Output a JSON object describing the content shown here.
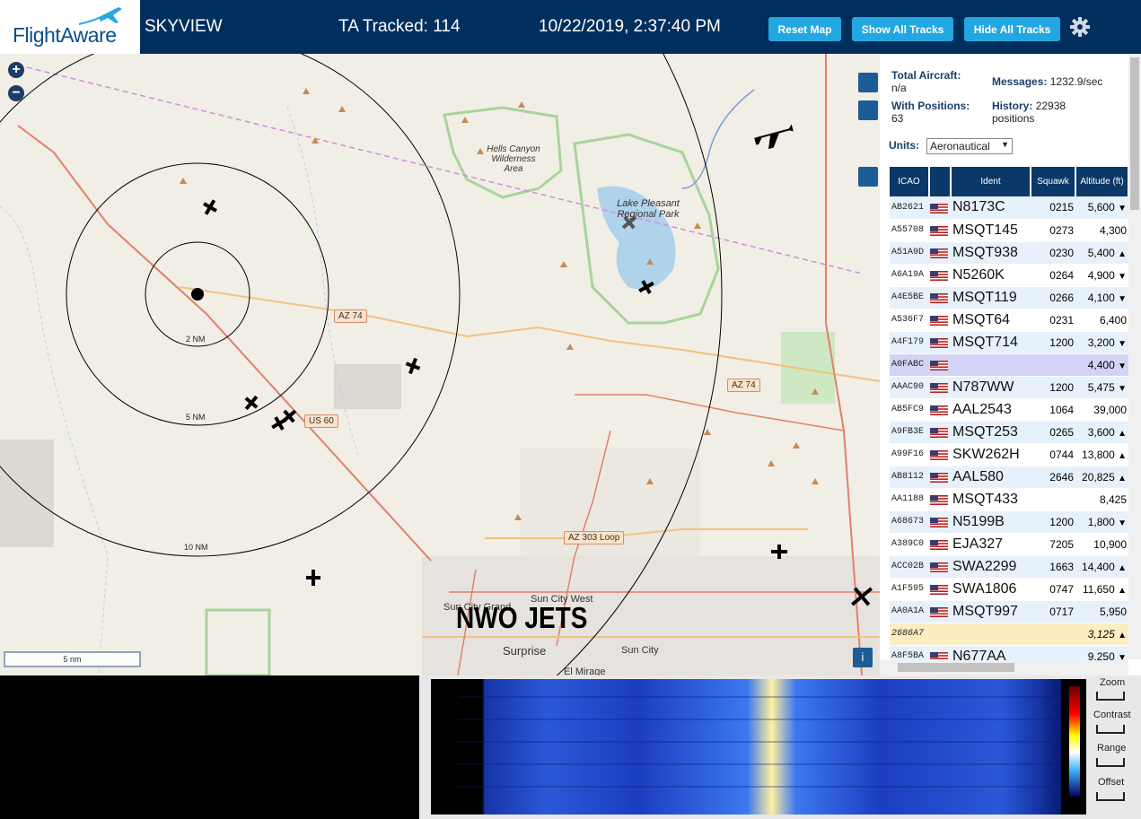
{
  "header": {
    "logo": "FlightAware",
    "app": "SKYVIEW",
    "tracked": "TA Tracked: 114",
    "datetime": "10/22/2019, 2:37:40 PM",
    "reset": "Reset Map",
    "show": "Show All Tracks",
    "hide": "Hide All Tracks",
    "settings_icon": "gear-icon"
  },
  "map": {
    "zoom_in": "+",
    "zoom_out": "−",
    "overlay": "NWO JETS",
    "scale": "5 nm",
    "range_rings": [
      "2 NM",
      "5 NM",
      "10 NM"
    ],
    "place_labels": [
      "Hells Canyon Wilderness Area",
      "Lake Pleasant Regional Park",
      "Sun City West",
      "Sun City Grand",
      "Surprise",
      "Sun City",
      "El Mirage"
    ],
    "roads": [
      "AZ 74",
      "AZ 74",
      "US 60",
      "AZ 303 Loop"
    ],
    "info": "i"
  },
  "panel": {
    "total_label": "Total Aircraft:",
    "total_val": "n/a",
    "pos_label": "With Positions:",
    "pos_val": "63",
    "msg_label": "Messages:",
    "msg_val": "1232.9/sec",
    "hist_label": "History:",
    "hist_val": "22938",
    "hist_unit": "positions",
    "units_label": "Units:",
    "units_val": "Aeronautical",
    "columns": [
      "ICAO",
      "",
      "Ident",
      "Squawk",
      "Altitude (ft)"
    ],
    "rows": [
      {
        "icao": "AB2621",
        "ident": "N8173C",
        "squawk": "0215",
        "alt": "5,600",
        "trend": "▼"
      },
      {
        "icao": "A55708",
        "ident": "MSQT145",
        "squawk": "0273",
        "alt": "4,300",
        "trend": ""
      },
      {
        "icao": "A51A9D",
        "ident": "MSQT938",
        "squawk": "0230",
        "alt": "5,400",
        "trend": "▲"
      },
      {
        "icao": "A6A19A",
        "ident": "N5260K",
        "squawk": "0264",
        "alt": "4,900",
        "trend": "▼"
      },
      {
        "icao": "A4E5BE",
        "ident": "MSQT119",
        "squawk": "0266",
        "alt": "4,100",
        "trend": "▼"
      },
      {
        "icao": "A536F7",
        "ident": "MSQT64",
        "squawk": "0231",
        "alt": "6,400",
        "trend": ""
      },
      {
        "icao": "A4F179",
        "ident": "MSQT714",
        "squawk": "1200",
        "alt": "3,200",
        "trend": "▼"
      },
      {
        "icao": "A0FABC",
        "ident": "",
        "squawk": "",
        "alt": "4,400",
        "trend": "▼"
      },
      {
        "icao": "AAAC90",
        "ident": "N787WW",
        "squawk": "1200",
        "alt": "5,475",
        "trend": "▼"
      },
      {
        "icao": "AB5FC9",
        "ident": "AAL2543",
        "squawk": "1064",
        "alt": "39,000",
        "trend": ""
      },
      {
        "icao": "A9FB3E",
        "ident": "MSQT253",
        "squawk": "0265",
        "alt": "3,600",
        "trend": "▲"
      },
      {
        "icao": "A99F16",
        "ident": "SKW262H",
        "squawk": "0744",
        "alt": "13,800",
        "trend": "▲"
      },
      {
        "icao": "AB8112",
        "ident": "AAL580",
        "squawk": "2646",
        "alt": "20,825",
        "trend": "▲"
      },
      {
        "icao": "AA1188",
        "ident": "MSQT433",
        "squawk": "",
        "alt": "8,425",
        "trend": ""
      },
      {
        "icao": "A68673",
        "ident": "N5199B",
        "squawk": "1200",
        "alt": "1,800",
        "trend": "▼"
      },
      {
        "icao": "A389C0",
        "ident": "EJA327",
        "squawk": "7205",
        "alt": "10,900",
        "trend": ""
      },
      {
        "icao": "ACC02B",
        "ident": "SWA2299",
        "squawk": "1663",
        "alt": "14,400",
        "trend": "▲"
      },
      {
        "icao": "A1F595",
        "ident": "SWA1806",
        "squawk": "0747",
        "alt": "11,650",
        "trend": "▲"
      },
      {
        "icao": "AA0A1A",
        "ident": "MSQT997",
        "squawk": "0717",
        "alt": "5,950",
        "trend": ""
      },
      {
        "icao": "2686A7",
        "ident": "",
        "squawk": "",
        "alt": "3,125",
        "trend": "▲"
      },
      {
        "icao": "A8F5BA",
        "ident": "N677AA",
        "squawk": "",
        "alt": "9,250",
        "trend": "▼"
      }
    ]
  },
  "spectrum": {
    "controls": [
      "Zoom",
      "Contrast",
      "Range",
      "Offset"
    ]
  }
}
